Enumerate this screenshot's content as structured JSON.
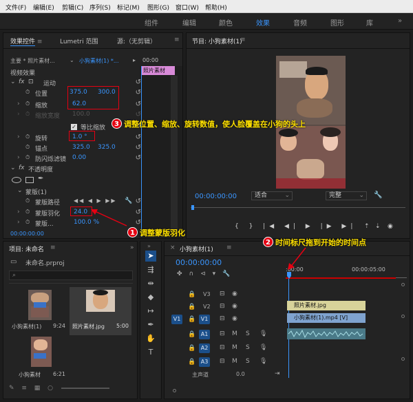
{
  "menu": [
    "文件(F)",
    "编辑(E)",
    "剪辑(C)",
    "序列(S)",
    "标记(M)",
    "图形(G)",
    "窗口(W)",
    "帮助(H)"
  ],
  "workspaces": [
    "组件",
    "编辑",
    "颜色",
    "效果",
    "音频",
    "图形",
    "库"
  ],
  "active_workspace": "效果",
  "effect_controls": {
    "tab1": "效果控件",
    "tab2": "Lumetri 范围",
    "tab3": "源:（无剪辑）",
    "master": "主要 * 照片素材...",
    "sequence_clip": "小狗素材(1) *...",
    "ruler_time": "00:00",
    "clip_label": "照片素材",
    "video_effects": "视频效果",
    "motion": "运动",
    "position_label": "位置",
    "position_x": "375.0",
    "position_y": "300.0",
    "scale_label": "缩放",
    "scale_value": "62.0",
    "scale_width_label": "缩放宽度",
    "scale_width_value": "100.0",
    "uniform_scale": "等比缩放",
    "rotation_label": "旋转",
    "rotation_value": "1.0 °",
    "anchor_label": "锚点",
    "anchor_x": "325.0",
    "anchor_y": "325.0",
    "antiflicker_label": "防闪烁滤镜",
    "antiflicker_value": "0.00",
    "opacity_label": "不透明度",
    "mask_label": "蒙版(1)",
    "mask_path_label": "蒙版路径",
    "mask_feather_label": "蒙版羽化",
    "mask_feather_value": "24.0",
    "mask_expand_label": "蒙版...",
    "mask_expand_value": "100.0 %",
    "timecode": "00:00:00:00"
  },
  "program": {
    "title": "节目: 小狗素材(1)",
    "timecode": "00:00:00:00",
    "fit": "适合",
    "quality": "完整"
  },
  "project": {
    "title": "项目: 未命名",
    "file": "未命名.prproj",
    "items": [
      {
        "name": "小狗素材(1)",
        "duration": "9:24"
      },
      {
        "name": "照片素材.jpg",
        "duration": "5:00"
      },
      {
        "name": "小狗素材",
        "duration": "6:21"
      }
    ]
  },
  "timeline": {
    "title": "小狗素材(1)",
    "timecode": "00:00:00:00",
    "ruler_start": ":00:00",
    "ruler_mid": "00:00:05:00",
    "tracks_video": [
      "V3",
      "V2",
      "V1"
    ],
    "tracks_audio": [
      "A1",
      "A2",
      "A3"
    ],
    "source_v": "V1",
    "source_a": "A1",
    "master_label": "主声道",
    "master_value": "0.0",
    "clip_photo": "照片素材.jpg",
    "clip_video": "小狗素材(1).mp4 [V]"
  },
  "annotations": {
    "a1": "调整蒙版羽化",
    "a2": "时间标尺拖到开始的时间点",
    "a3": "调整位置、缩放、旋转数值，使人脸覆盖在小狗的头上",
    "n1": "1",
    "n2": "2",
    "n3": "3"
  },
  "colors": {
    "accent": "#3a96ff",
    "annotation": "#ffe100",
    "marker": "#e60012"
  }
}
